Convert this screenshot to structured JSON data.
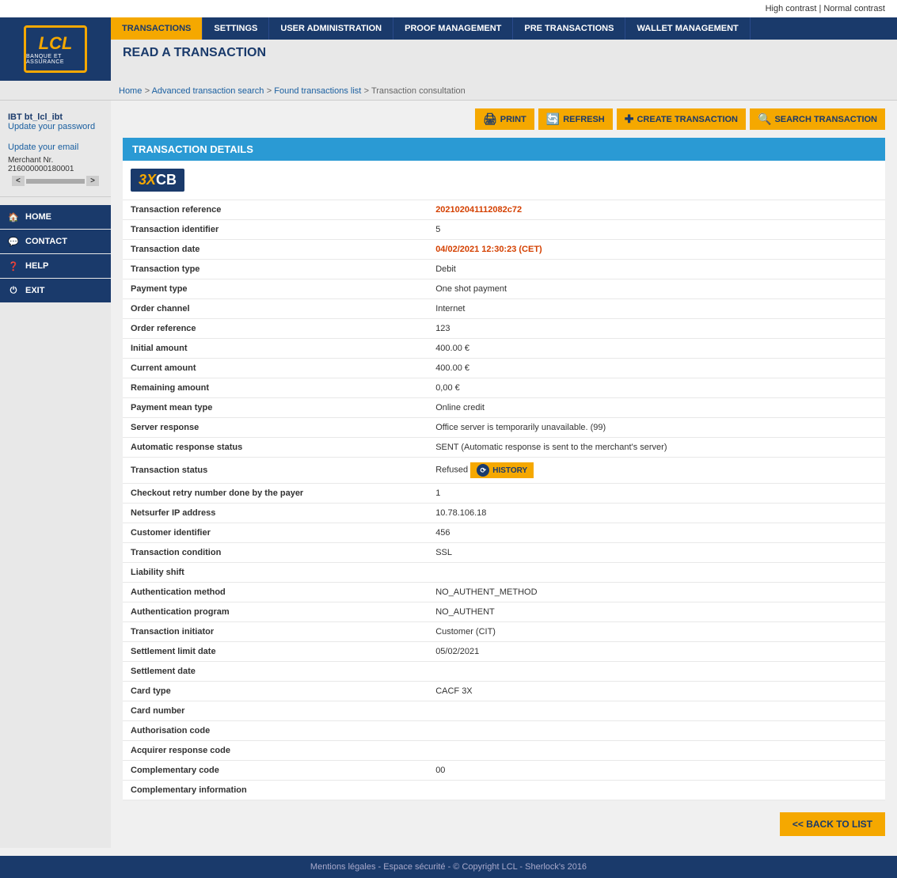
{
  "topbar": {
    "high_contrast": "High contrast",
    "normal_contrast": "Normal contrast",
    "separator": "|"
  },
  "nav": {
    "tabs": [
      {
        "id": "transactions",
        "label": "TRANSACTIONS",
        "active": true
      },
      {
        "id": "settings",
        "label": "SETTINGS",
        "active": false
      },
      {
        "id": "user-admin",
        "label": "USER ADMINISTRATION",
        "active": false
      },
      {
        "id": "proof-mgmt",
        "label": "PROOF MANAGEMENT",
        "active": false
      },
      {
        "id": "pre-transactions",
        "label": "PRE TRANSACTIONS",
        "active": false
      },
      {
        "id": "wallet-mgmt",
        "label": "WALLET MANAGEMENT",
        "active": false
      }
    ]
  },
  "page": {
    "title": "READ A TRANSACTION"
  },
  "breadcrumb": {
    "home": "Home",
    "advanced_search": "Advanced transaction search",
    "found_list": "Found transactions list",
    "current": "Transaction consultation"
  },
  "sidebar": {
    "username": "IBT bt_lcl_ibt",
    "update_password": "Update your password",
    "update_email": "Update your email",
    "merchant_label": "Merchant Nr.",
    "merchant_number": "216000000180001",
    "nav_items": [
      {
        "id": "home",
        "label": "HOME",
        "icon": "🏠"
      },
      {
        "id": "contact",
        "label": "CONTACT",
        "icon": "💬"
      },
      {
        "id": "help",
        "label": "HELP",
        "icon": "❓"
      },
      {
        "id": "exit",
        "label": "EXIT",
        "icon": "⏻"
      }
    ]
  },
  "toolbar": {
    "print": "PRINT",
    "refresh": "REFRESH",
    "create": "CREATE TRANSACTION",
    "search": "SEARCH TRANSACTION"
  },
  "section": {
    "title": "TRANSACTION DETAILS"
  },
  "transaction": {
    "logo_text": "3XCB",
    "fields": [
      {
        "label": "Transaction reference",
        "value": "202102041112082c72",
        "type": "link"
      },
      {
        "label": "Transaction identifier",
        "value": "5",
        "type": "text"
      },
      {
        "label": "Transaction date",
        "value": "04/02/2021 12:30:23 (CET)",
        "type": "date"
      },
      {
        "label": "Transaction type",
        "value": "Debit",
        "type": "text"
      },
      {
        "label": "Payment type",
        "value": "One shot payment",
        "type": "text"
      },
      {
        "label": "Order channel",
        "value": "Internet",
        "type": "text"
      },
      {
        "label": "Order reference",
        "value": "123",
        "type": "text"
      },
      {
        "label": "Initial amount",
        "value": "400.00 €",
        "type": "text"
      },
      {
        "label": "Current amount",
        "value": "400.00 €",
        "type": "text"
      },
      {
        "label": "Remaining amount",
        "value": "0,00 €",
        "type": "text"
      },
      {
        "label": "Payment mean type",
        "value": "Online credit",
        "type": "text"
      },
      {
        "label": "Server response",
        "value": "Office server is temporarily unavailable. (99)",
        "type": "text"
      },
      {
        "label": "Automatic response status",
        "value": "SENT (Automatic response is sent to the merchant's server)",
        "type": "text"
      },
      {
        "label": "Transaction status",
        "value": "Refused",
        "type": "status"
      },
      {
        "label": "Checkout retry number done by the payer",
        "value": "1",
        "type": "text"
      },
      {
        "label": "Netsurfer IP address",
        "value": "10.78.106.18",
        "type": "text"
      },
      {
        "label": "Customer identifier",
        "value": "456",
        "type": "text"
      },
      {
        "label": "Transaction condition",
        "value": "SSL",
        "type": "text"
      },
      {
        "label": "Liability shift",
        "value": "",
        "type": "text"
      },
      {
        "label": "Authentication method",
        "value": "NO_AUTHENT_METHOD",
        "type": "text"
      },
      {
        "label": "Authentication program",
        "value": "NO_AUTHENT",
        "type": "text"
      },
      {
        "label": "Transaction initiator",
        "value": "Customer (CIT)",
        "type": "text"
      },
      {
        "label": "Settlement limit date",
        "value": "05/02/2021",
        "type": "text"
      },
      {
        "label": "Settlement date",
        "value": "",
        "type": "text"
      },
      {
        "label": "Card type",
        "value": "CACF 3X",
        "type": "text"
      },
      {
        "label": "Card number",
        "value": "",
        "type": "text"
      },
      {
        "label": "Authorisation code",
        "value": "",
        "type": "text"
      },
      {
        "label": "Acquirer response code",
        "value": "",
        "type": "text"
      },
      {
        "label": "Complementary code",
        "value": "00",
        "type": "text"
      },
      {
        "label": "Complementary information",
        "value": "",
        "type": "text"
      }
    ],
    "history_label": "HISTORY"
  },
  "back_button": "<< BACK TO LIST",
  "footer": {
    "text": "Mentions légales - Espace sécurité - © Copyright LCL - Sherlock's 2016"
  }
}
